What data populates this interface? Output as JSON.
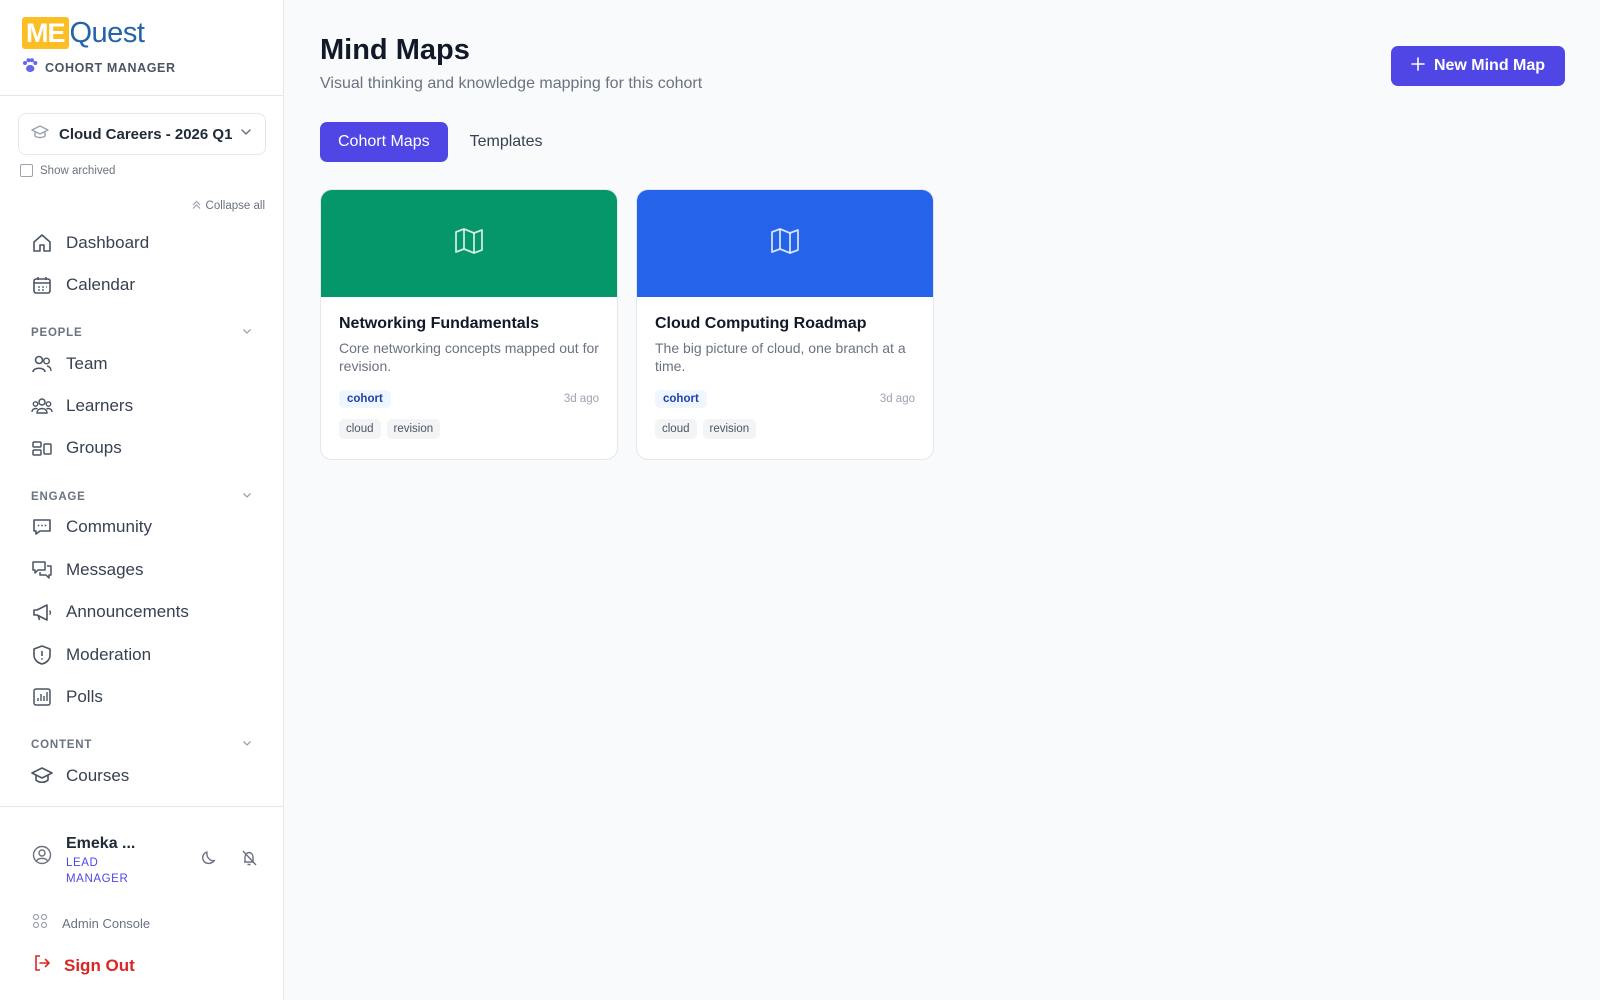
{
  "brand": {
    "logo_me": "ME",
    "logo_quest": "Quest",
    "subtitle": "COHORT MANAGER"
  },
  "cohort_select": {
    "value": "Cloud Careers - 2026 Q1"
  },
  "show_archived": {
    "label": "Show archived",
    "checked": false
  },
  "collapse_all": {
    "label": "Collapse all"
  },
  "nav": {
    "top": [
      {
        "label": "Dashboard",
        "icon": "home-icon"
      },
      {
        "label": "Calendar",
        "icon": "calendar-icon"
      }
    ],
    "people": {
      "heading": "PEOPLE",
      "items": [
        {
          "label": "Team",
          "icon": "users-icon"
        },
        {
          "label": "Learners",
          "icon": "learners-icon"
        },
        {
          "label": "Groups",
          "icon": "groups-icon"
        }
      ]
    },
    "engage": {
      "heading": "ENGAGE",
      "items": [
        {
          "label": "Community",
          "icon": "chat-icon"
        },
        {
          "label": "Messages",
          "icon": "messages-icon"
        },
        {
          "label": "Announcements",
          "icon": "megaphone-icon"
        },
        {
          "label": "Moderation",
          "icon": "shield-icon"
        },
        {
          "label": "Polls",
          "icon": "bar-chart-icon"
        }
      ]
    },
    "content": {
      "heading": "CONTENT",
      "items": [
        {
          "label": "Courses",
          "icon": "graduation-cap-icon"
        }
      ]
    }
  },
  "user": {
    "name": "Emeka ...",
    "role": "LEAD MANAGER"
  },
  "footer": {
    "admin_console": "Admin Console",
    "sign_out": "Sign Out"
  },
  "page": {
    "title": "Mind Maps",
    "subtitle": "Visual thinking and knowledge mapping for this cohort",
    "new_button": "New Mind Map"
  },
  "tabs": [
    {
      "label": "Cohort Maps",
      "active": true
    },
    {
      "label": "Templates",
      "active": false
    }
  ],
  "cards": [
    {
      "title": "Networking Fundamentals",
      "description": "Core networking concepts mapped out for revision.",
      "badge": "cohort",
      "time": "3d ago",
      "tags": [
        "cloud",
        "revision"
      ],
      "color": "#059669"
    },
    {
      "title": "Cloud Computing Roadmap",
      "description": "The big picture of cloud, one branch at a time.",
      "badge": "cohort",
      "time": "3d ago",
      "tags": [
        "cloud",
        "revision"
      ],
      "color": "#2563eb"
    }
  ],
  "colors": {
    "accent": "#4f46e5",
    "danger": "#dc2626",
    "logo_yellow": "#fbbf24",
    "logo_blue": "#2563a8"
  }
}
